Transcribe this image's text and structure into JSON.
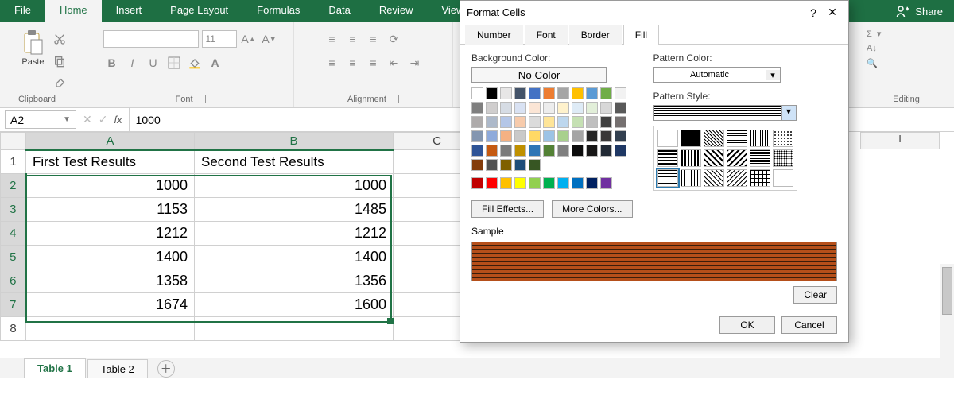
{
  "ribbon": {
    "tabs": [
      "File",
      "Home",
      "Insert",
      "Page Layout",
      "Formulas",
      "Data",
      "Review",
      "View"
    ],
    "active": "Home",
    "share": "Share"
  },
  "groups": {
    "clipboard": "Clipboard",
    "paste": "Paste",
    "font": "Font",
    "alignment": "Alignment",
    "editing": "Editing"
  },
  "font": {
    "name": "",
    "size": "11",
    "buttons": {
      "bold": "B",
      "italic": "I",
      "underline": "U"
    }
  },
  "namebox": "A2",
  "fx": "fx",
  "formula_value": "1000",
  "columns": [
    "A",
    "B",
    "C"
  ],
  "extra_col": "I",
  "rows": [
    {
      "n": "1",
      "a": "First Test Results",
      "b": "Second Test Results",
      "hdr": true
    },
    {
      "n": "2",
      "a": "1000",
      "b": "1000"
    },
    {
      "n": "3",
      "a": "1153",
      "b": "1485"
    },
    {
      "n": "4",
      "a": "1212",
      "b": "1212"
    },
    {
      "n": "5",
      "a": "1400",
      "b": "1400"
    },
    {
      "n": "6",
      "a": "1358",
      "b": "1356"
    },
    {
      "n": "7",
      "a": "1674",
      "b": "1600"
    },
    {
      "n": "8",
      "a": "",
      "b": ""
    }
  ],
  "sheet_tabs": {
    "t1": "Table 1",
    "t2": "Table 2"
  },
  "dialog": {
    "title": "Format Cells",
    "help": "?",
    "close": "✕",
    "tabs": {
      "number": "Number",
      "font": "Font",
      "border": "Border",
      "fill": "Fill"
    },
    "bg_label": "Background Color:",
    "nocolor": "No Color",
    "fill_effects": "Fill Effects...",
    "more_colors": "More Colors...",
    "pattern_color_label": "Pattern Color:",
    "automatic": "Automatic",
    "pattern_style_label": "Pattern Style:",
    "sample": "Sample",
    "clear": "Clear",
    "ok": "OK",
    "cancel": "Cancel"
  },
  "theme_colors": [
    "#ffffff",
    "#000000",
    "#e7e6e6",
    "#44546a",
    "#4472c4",
    "#ed7d31",
    "#a5a5a5",
    "#ffc000",
    "#5b9bd5",
    "#70ad47",
    "#f2f2f2",
    "#7f7f7f",
    "#d0cece",
    "#d6dce4",
    "#d9e2f3",
    "#fbe5d5",
    "#ededed",
    "#fff2cc",
    "#deebf6",
    "#e2efd9",
    "#d8d8d8",
    "#595959",
    "#aeabab",
    "#adb9ca",
    "#b4c6e7",
    "#f7cbac",
    "#dbdbdb",
    "#fee599",
    "#bdd7ee",
    "#c5e0b3",
    "#bfbfbf",
    "#3f3f3f",
    "#757070",
    "#8496b0",
    "#8eaadb",
    "#f4b183",
    "#c9c9c9",
    "#ffd965",
    "#9cc3e5",
    "#a8d08d",
    "#a5a5a5",
    "#262626",
    "#3a3838",
    "#323f4f",
    "#2f5496",
    "#c55a11",
    "#7b7b7b",
    "#bf9000",
    "#2e75b5",
    "#538135",
    "#7f7f7f",
    "#0c0c0c",
    "#171616",
    "#222a35",
    "#1f3864",
    "#833c0b",
    "#525252",
    "#7f6000",
    "#1e4e79",
    "#375623"
  ],
  "std_colors": [
    "#c00000",
    "#ff0000",
    "#ffc000",
    "#ffff00",
    "#92d050",
    "#00b050",
    "#00b0f0",
    "#0070c0",
    "#002060",
    "#7030a0"
  ]
}
